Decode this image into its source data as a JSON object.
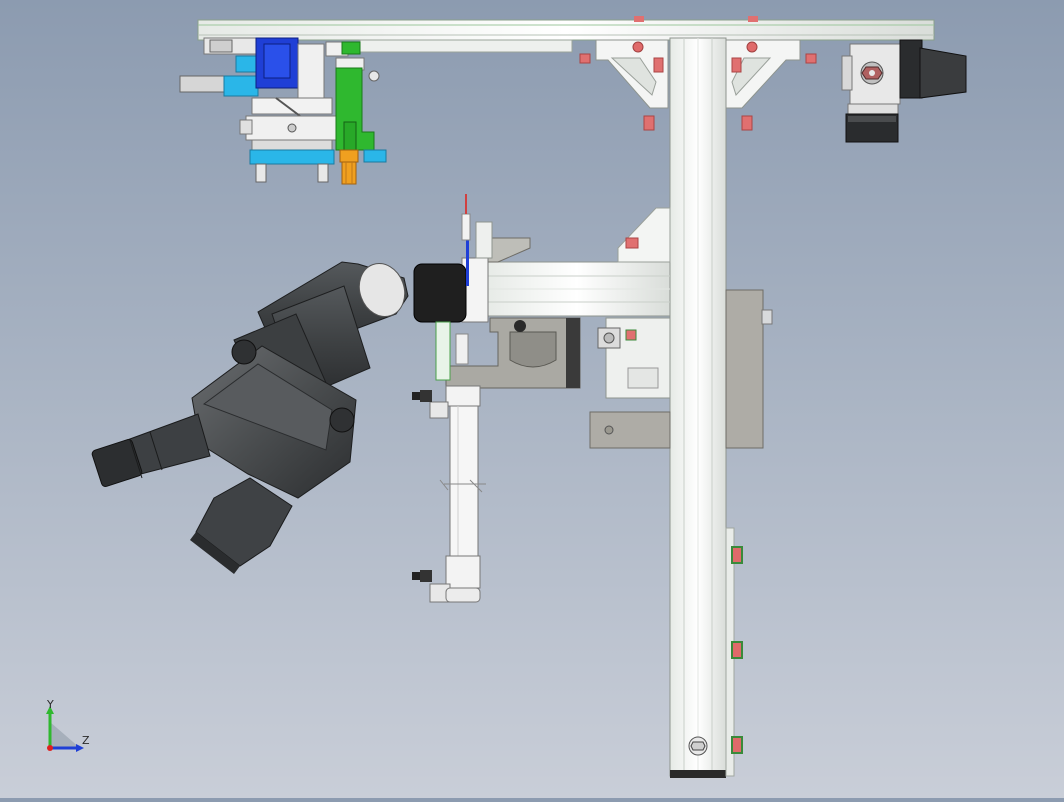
{
  "viewport": {
    "background_top": "#8c9bb0",
    "background_bottom": "#c9ced8",
    "model_colors": {
      "frame": "#f2f4f2",
      "frame_edge": "#9aa39a",
      "microscope_body": "#4a4d4f",
      "microscope_dark": "#2f3133",
      "bracket_grey": "#a9a9a4",
      "blue_block": "#1f3fd6",
      "cyan_plate": "#2ab6e8",
      "green_bar": "#2fb82f",
      "orange_part": "#f0a020",
      "red_knob": "#e05a5a"
    }
  },
  "triad": {
    "y_label": "Y",
    "z_label": "Z",
    "icon": "coordinate-triad-icon"
  }
}
